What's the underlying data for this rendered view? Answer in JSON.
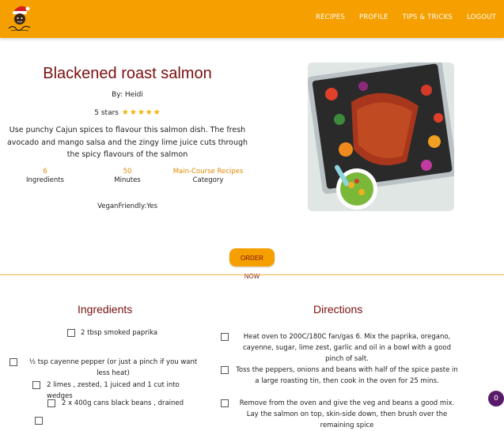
{
  "nav": {
    "logo_alt": "logo",
    "links": [
      "RECIPES",
      "PROFILE",
      "TIPS & TRICKS",
      "LOGOUT"
    ]
  },
  "recipe": {
    "title": "Blackened roast salmon",
    "author": "By: Heidi",
    "rating_text": "5 stars",
    "stars": 5,
    "description": "Use punchy Cajun spices to flavour this salmon dish. The fresh avocado and mango salsa and the zingy lime juice cuts through the spicy flavours of the salmon",
    "stats": [
      {
        "value": "6",
        "label": "Ingredients"
      },
      {
        "value": "50",
        "label": "Minutes"
      },
      {
        "value": "Main-Course Recipes",
        "label": "Category"
      }
    ],
    "vegan": "VeganFriendly:Yes"
  },
  "order_button": "ORDER NOW",
  "ingredients": {
    "heading": "Ingredients",
    "items": [
      "2 tbsp smoked paprika",
      "½ tsp cayenne pepper (or just a pinch if you want less heat)",
      "2 limes , zested, 1 juiced and 1 cut into wedges",
      "2 x 400g cans black beans , drained"
    ]
  },
  "directions": {
    "heading": "Directions",
    "items": [
      "Heat oven to 200C/180C fan/gas 6. Mix the paprika, oregano, cayenne, sugar, lime zest, garlic and oil in a bowl with a good pinch of salt.",
      "Toss the peppers, onions and beans with half of the spice paste in a large roasting tin, then cook in the oven for 25 mins.",
      "Remove from the oven and give the veg and beans a good mix. Lay the salmon on top, skin-side down, then brush over the remaining spice"
    ]
  },
  "badge": "0",
  "colors": {
    "navbar": "#f5a000",
    "title": "#7a0f0f",
    "stat_value": "#e08a00",
    "star": "#f5b000",
    "badge": "#5a1a6a"
  }
}
